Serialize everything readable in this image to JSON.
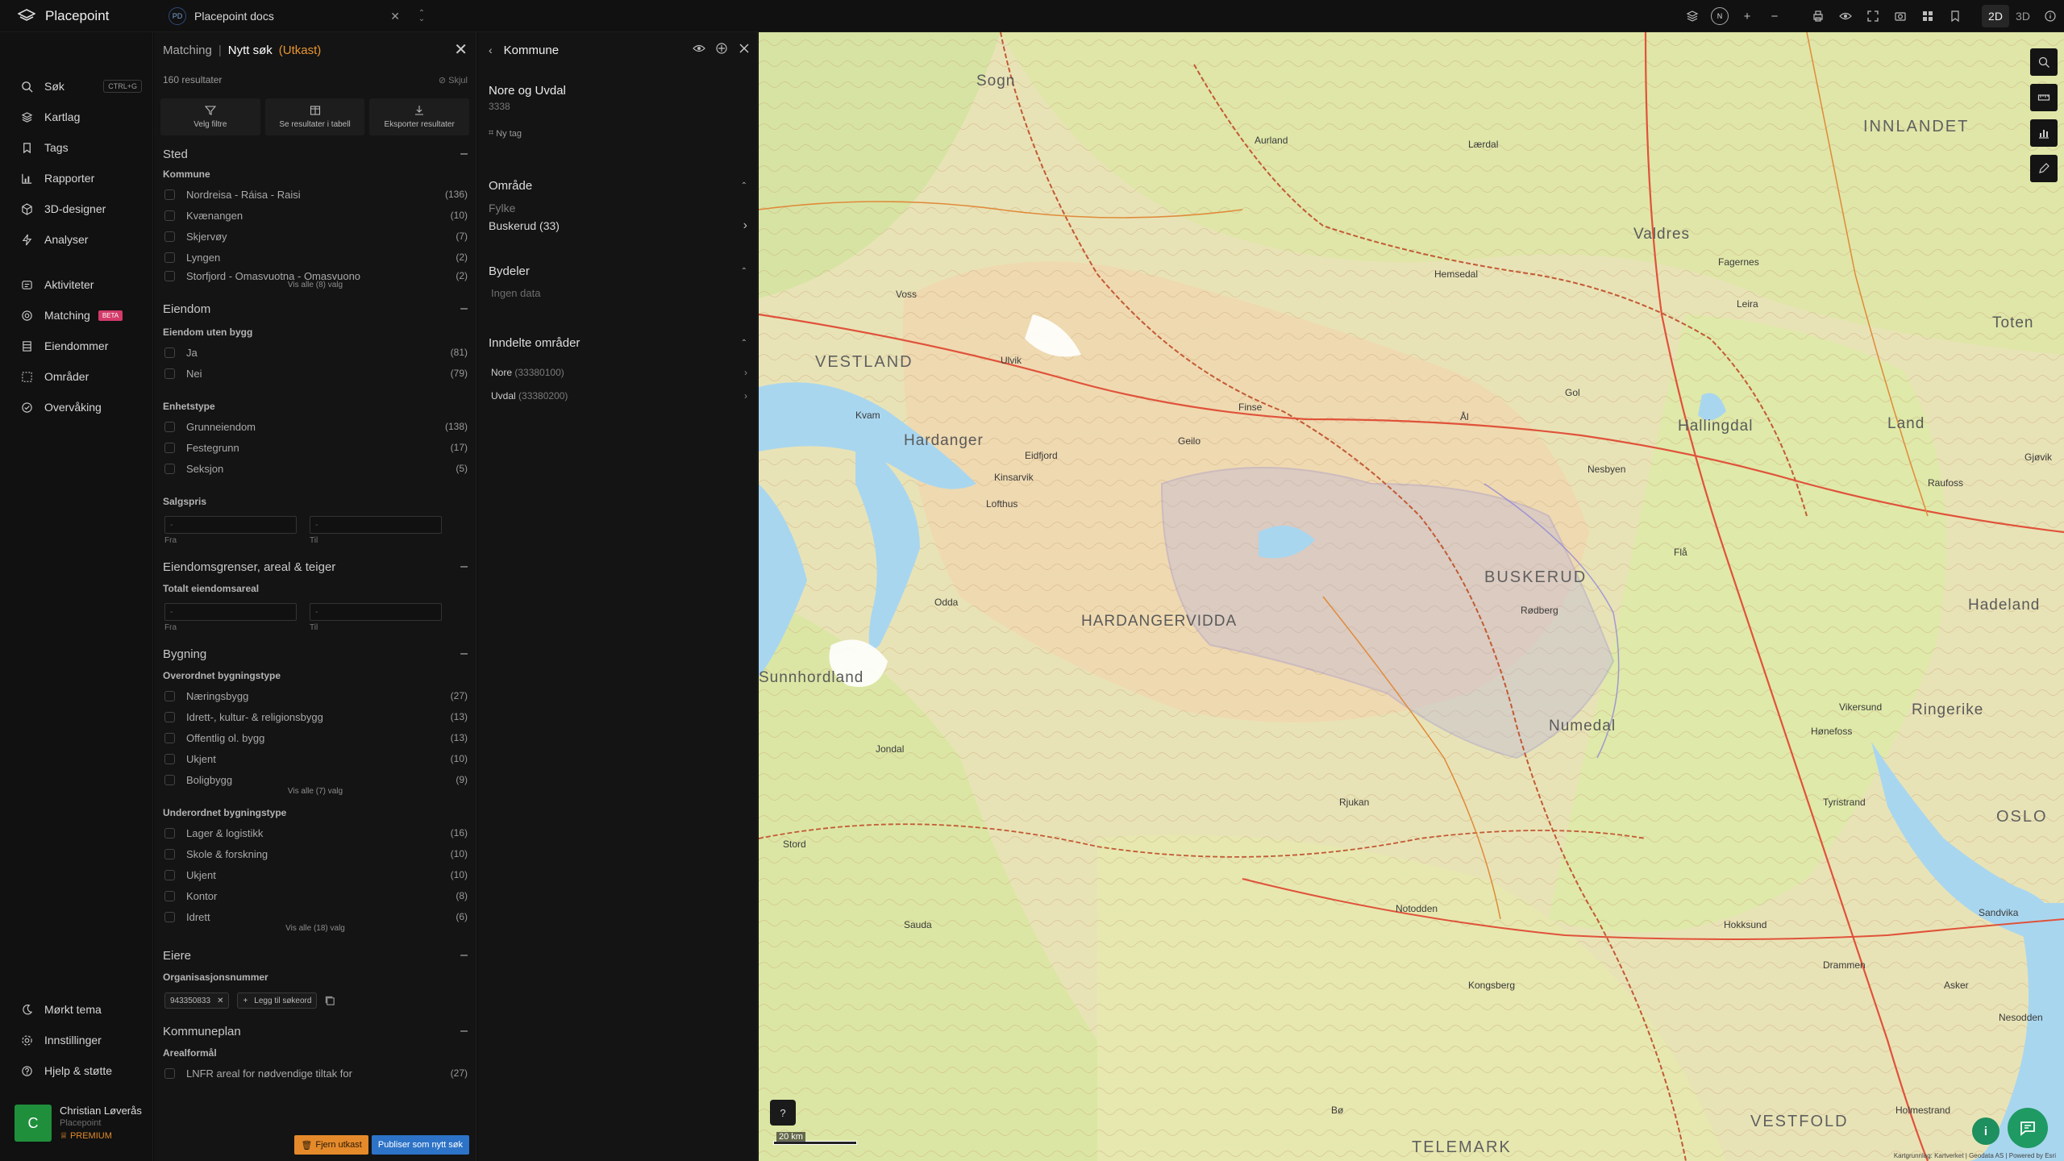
{
  "app": {
    "name": "Placepoint"
  },
  "workspace": {
    "initials": "PD",
    "name": "Placepoint docs"
  },
  "toolbar": {
    "mode_2d": "2D",
    "mode_3d": "3D",
    "compass": "N"
  },
  "sidebar": {
    "search": {
      "label": "Søk",
      "shortcut": "CTRL+G"
    },
    "items_top": [
      {
        "label": "Kartlag",
        "icon": "layers-icon"
      },
      {
        "label": "Tags",
        "icon": "bookmark-icon"
      },
      {
        "label": "Rapporter",
        "icon": "chart-icon"
      },
      {
        "label": "3D-designer",
        "icon": "cube-icon"
      },
      {
        "label": "Analyser",
        "icon": "bolt-icon"
      }
    ],
    "items_mid": [
      {
        "label": "Aktiviteter",
        "icon": "activity-icon"
      },
      {
        "label": "Matching",
        "icon": "matching-icon",
        "badge": "BETA"
      },
      {
        "label": "Eiendommer",
        "icon": "building-icon"
      },
      {
        "label": "Områder",
        "icon": "area-icon"
      },
      {
        "label": "Overvåking",
        "icon": "monitor-icon"
      }
    ],
    "items_bottom": [
      {
        "label": "Mørkt tema",
        "icon": "moon-icon"
      },
      {
        "label": "Innstillinger",
        "icon": "gear-icon"
      },
      {
        "label": "Hjelp & støtte",
        "icon": "help-icon"
      }
    ],
    "user": {
      "initial": "C",
      "name": "Christian Løverås",
      "org": "Placepoint",
      "plan": "PREMIUM"
    }
  },
  "matching": {
    "crumb": "Matching",
    "separator": "|",
    "title": "Nytt søk",
    "status": "(Utkast)",
    "results": "160 resultater",
    "hide": "Skjul",
    "actions": [
      "Velg filtre",
      "Se resultater i tabell",
      "Eksporter resultater"
    ],
    "sted": {
      "title": "Sted",
      "kommune": {
        "label": "Kommune",
        "options": [
          {
            "label": "Nordreisa - Ráisa - Raisi",
            "count": "(136)"
          },
          {
            "label": "Kvænangen",
            "count": "(10)"
          },
          {
            "label": "Skjervøy",
            "count": "(7)"
          },
          {
            "label": "Lyngen",
            "count": "(2)"
          },
          {
            "label": "Storfjord - Omasvuotna - Omasvuono",
            "count": "(2)"
          }
        ],
        "show_all": "Vis alle (8) valg"
      }
    },
    "eiendom": {
      "title": "Eiendom",
      "uten_bygg": {
        "label": "Eiendom uten bygg",
        "options": [
          {
            "label": "Ja",
            "count": "(81)"
          },
          {
            "label": "Nei",
            "count": "(79)"
          }
        ]
      },
      "enhetstype": {
        "label": "Enhetstype",
        "options": [
          {
            "label": "Grunneiendom",
            "count": "(138)"
          },
          {
            "label": "Festegrunn",
            "count": "(17)"
          },
          {
            "label": "Seksjon",
            "count": "(5)"
          }
        ]
      },
      "salgspris": {
        "label": "Salgspris",
        "from": "Fra",
        "to": "Til",
        "placeholder": "-"
      }
    },
    "grenser": {
      "title": "Eiendomsgrenser, areal & teiger",
      "areal": {
        "label": "Totalt eiendomsareal",
        "from": "Fra",
        "to": "Til",
        "placeholder": "-"
      }
    },
    "bygning": {
      "title": "Bygning",
      "overordnet": {
        "label": "Overordnet bygningstype",
        "options": [
          {
            "label": "Næringsbygg",
            "count": "(27)"
          },
          {
            "label": "Idrett-, kultur- & religionsbygg",
            "count": "(13)"
          },
          {
            "label": "Offentlig ol. bygg",
            "count": "(13)"
          },
          {
            "label": "Ukjent",
            "count": "(10)"
          },
          {
            "label": "Boligbygg",
            "count": "(9)"
          }
        ],
        "show_all": "Vis alle (7) valg"
      },
      "underordnet": {
        "label": "Underordnet bygningstype",
        "options": [
          {
            "label": "Lager & logistikk",
            "count": "(16)"
          },
          {
            "label": "Skole & forskning",
            "count": "(10)"
          },
          {
            "label": "Ukjent",
            "count": "(10)"
          },
          {
            "label": "Kontor",
            "count": "(8)"
          },
          {
            "label": "Idrett",
            "count": "(6)"
          }
        ],
        "show_all": "Vis alle (18) valg"
      }
    },
    "eiere": {
      "title": "Eiere",
      "org_label": "Organisasjonsnummer",
      "chip": "943350833",
      "add": "Legg til søkeord"
    },
    "kommuneplan": {
      "title": "Kommuneplan",
      "arealformal": "Arealformål",
      "partial": {
        "label": "LNFR areal for nødvendige tiltak for",
        "count": "(27)"
      }
    },
    "footer": {
      "remove": "Fjern utkast",
      "publish": "Publiser som nytt søk"
    }
  },
  "kommune": {
    "title": "Kommune",
    "name": "Nore og Uvdal",
    "code": "3338",
    "newtag": "Ny tag",
    "omrade": {
      "title": "Område",
      "fylke_label": "Fylke",
      "fylke_value": "Buskerud (33)"
    },
    "bydeler": {
      "title": "Bydeler",
      "empty": "Ingen data"
    },
    "inndelte": {
      "title": "Inndelte områder",
      "items": [
        {
          "name": "Nore",
          "code": "(33380100)"
        },
        {
          "name": "Uvdal",
          "code": "(33380200)"
        }
      ]
    }
  },
  "map": {
    "regions": [
      {
        "text": "VESTLAND",
        "cls": "big"
      },
      {
        "text": "INNLANDET",
        "cls": "big"
      },
      {
        "text": "BUSKERUD",
        "cls": "big"
      },
      {
        "text": "HARDANGERVIDDA",
        "cls": "region"
      },
      {
        "text": "VESTFOLD",
        "cls": "big"
      },
      {
        "text": "TELEMARK",
        "cls": "big"
      },
      {
        "text": "OSLO",
        "cls": "big"
      },
      {
        "text": "Hallingdal",
        "cls": "region"
      },
      {
        "text": "Hardanger",
        "cls": "region"
      },
      {
        "text": "Valdres",
        "cls": "region"
      },
      {
        "text": "Sunnhordland",
        "cls": "region"
      },
      {
        "text": "Ringerike",
        "cls": "region"
      },
      {
        "text": "Numedal",
        "cls": "region"
      },
      {
        "text": "Sogn",
        "cls": "region"
      },
      {
        "text": "Land",
        "cls": "region"
      },
      {
        "text": "Toten",
        "cls": "region"
      },
      {
        "text": "Hadeland",
        "cls": "region"
      }
    ],
    "towns": [
      "Voss",
      "Odda",
      "Geilo",
      "Gol",
      "Nesbyen",
      "Fagernes",
      "Rjukan",
      "Kongsberg",
      "Drammen",
      "Hønefoss",
      "Notodden",
      "Flå",
      "Ål",
      "Hemsedal",
      "Eidfjord",
      "Ulvik",
      "Rødberg",
      "Lærdal",
      "Aurland",
      "Leira",
      "Gjøvik",
      "Raufoss",
      "Sandvika",
      "Asker",
      "Nesodden",
      "Vikersund",
      "Tyristrand",
      "Finse",
      "Kvam",
      "Stord",
      "Jondal",
      "Kinsarvik",
      "Lofthus",
      "Sauda",
      "Bø",
      "Hokksund",
      "Holmestrand"
    ],
    "scale": "20 km",
    "attribution": "Kartgrunnlag: Kartverket | Geodata AS | Powered by Esri",
    "help": "?",
    "info": "i"
  },
  "colors": {
    "accent_orange": "#e9962f",
    "publish_blue": "#2d73c7",
    "beta_pink": "#d33a6a",
    "avatar_green": "#1f8f3c",
    "chat_green": "#1e9a62"
  }
}
